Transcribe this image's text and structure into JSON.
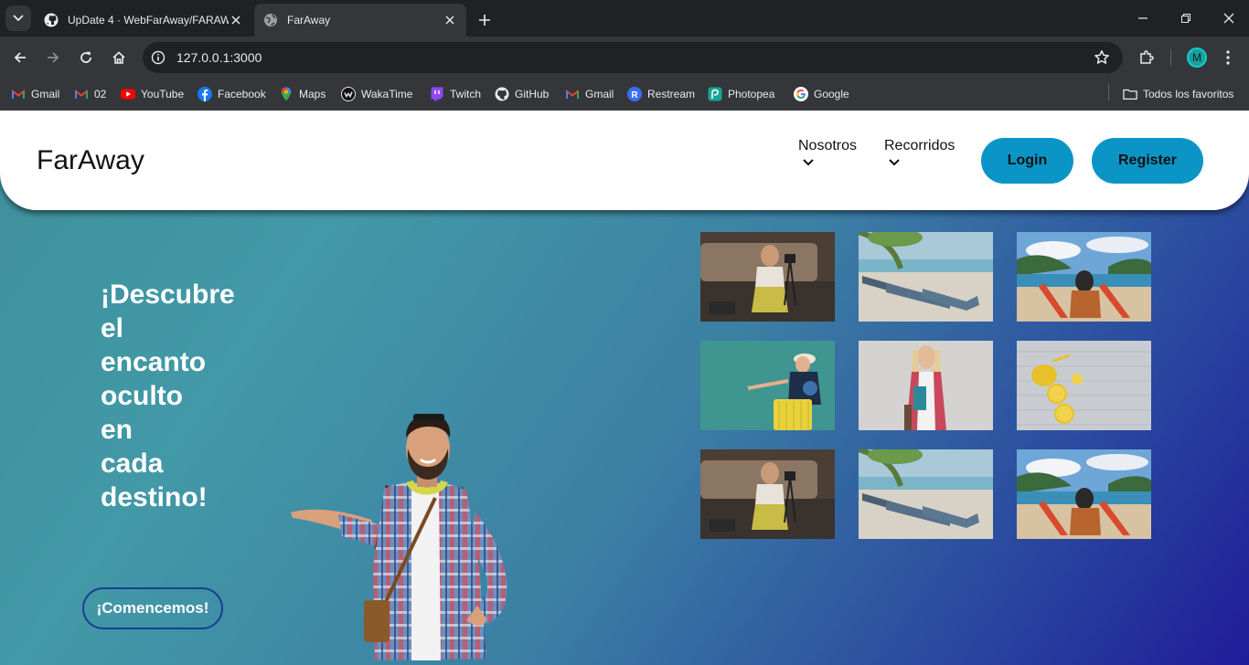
{
  "browser": {
    "tabs": [
      {
        "title": "UpDate 4 · WebFarAway/FARAW",
        "icon": "github-icon"
      },
      {
        "title": "FarAway",
        "icon": "globe-icon"
      }
    ],
    "url": "127.0.0.1:3000",
    "avatar_letter": "M",
    "bookmarks": [
      {
        "label": "Gmail",
        "icon": "gmail-icon"
      },
      {
        "label": "02",
        "icon": "gmail-icon"
      },
      {
        "label": "YouTube",
        "icon": "youtube-icon"
      },
      {
        "label": "Facebook",
        "icon": "facebook-icon"
      },
      {
        "label": "Maps",
        "icon": "maps-icon"
      },
      {
        "label": "WakaTime",
        "icon": "wakatime-icon"
      },
      {
        "label": "Twitch",
        "icon": "twitch-icon"
      },
      {
        "label": "GitHub",
        "icon": "github-icon"
      },
      {
        "label": "Gmail",
        "icon": "gmail-icon"
      },
      {
        "label": "Restream",
        "icon": "restream-icon"
      },
      {
        "label": "Photopea",
        "icon": "photopea-icon"
      },
      {
        "label": "Google",
        "icon": "google-icon"
      }
    ],
    "all_bookmarks": "Todos los favoritos"
  },
  "site": {
    "brand": "FarAway",
    "nav": [
      {
        "label": "Nosotros"
      },
      {
        "label": "Recorridos"
      }
    ],
    "login": "Login",
    "register": "Register",
    "hero_lines": [
      "¡Descubre",
      "el",
      "encanto",
      "oculto",
      "en",
      "cada",
      "destino!"
    ],
    "cta": "¡Comencemos!",
    "gallery": [
      "woman-camera-photo",
      "beach-loungers-photo",
      "beach-chairs-photo",
      "woman-globe-suitcase-photo",
      "woman-passport-photo",
      "lemons-photo",
      "woman-camera-photo",
      "beach-loungers-photo",
      "beach-chairs-photo"
    ]
  },
  "colors": {
    "button": "#0a95c6",
    "gradient_start": "#3e8f9b",
    "gradient_end": "#1f1c99",
    "cta_border": "#1a3f8e"
  }
}
